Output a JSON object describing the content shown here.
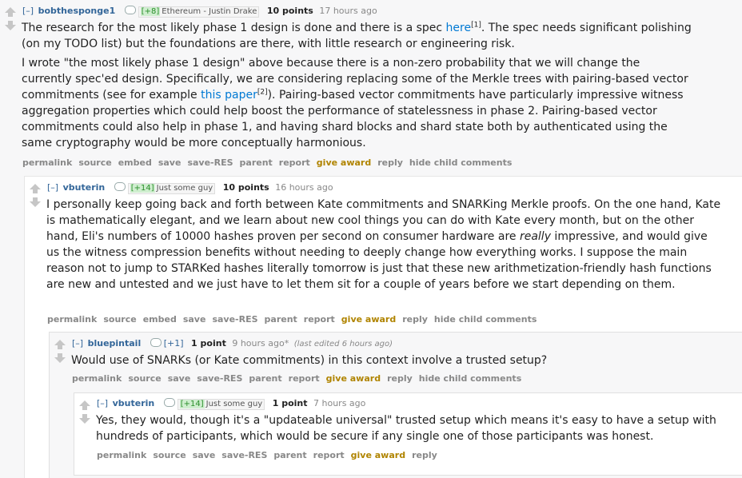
{
  "comments": [
    {
      "expand": "[–]",
      "author": "bobthesponge1",
      "karma": "[+8]",
      "flair": "Ethereum - Justin Drake",
      "score": "10 points",
      "time": "17 hours ago",
      "p1_a": "The research for the most likely phase 1 design is done and there is a spec ",
      "p1_link": "here",
      "p1_sup": "[1]",
      "p1_b": ". The spec needs significant polishing (on my TODO list) but the foundations are there, with little research or engineering risk.",
      "p2_a": "I wrote \"the most likely phase 1 design\" above because there is a non-zero probability that we will change the currently spec'ed design. Specifically, we are considering replacing some of the Merkle trees with pairing-based vector commitments (see for example ",
      "p2_link": "this paper",
      "p2_sup": "[2]",
      "p2_b": "). Pairing-based vector commitments have particularly impressive witness aggregation properties which could help boost the performance of statelessness in phase 2. Pairing-based vector commitments could also help in phase 1, and having shard blocks and shard state both by authenticated using the same cryptography would be more conceptually harmonious.",
      "buttons": [
        "permalink",
        "source",
        "embed",
        "save",
        "save-RES",
        "parent",
        "report",
        "give award",
        "reply",
        "hide child comments"
      ]
    },
    {
      "expand": "[–]",
      "author": "vbuterin",
      "karma": "[+14]",
      "flair": "Just some guy",
      "score": "10 points",
      "time": "16 hours ago",
      "p1_a": "I personally keep going back and forth between Kate commitments and SNARKing Merkle proofs. On the one hand, Kate is mathematically elegant, and we learn about new cool things you can do with Kate every month, but on the other hand, Eli's numbers of 10000 hashes proven per second on consumer hardware are ",
      "p1_em": "really",
      "p1_b": " impressive, and would give us the witness compression benefits without needing to deeply change how everything works. I suppose the main reason not to jump to STARKed hashes literally tomorrow is just that these new arithmetization-friendly hash functions are new and untested and we just have to let them sit for a couple of years before we start depending on them.",
      "buttons": [
        "permalink",
        "source",
        "embed",
        "save",
        "save-RES",
        "parent",
        "report",
        "give award",
        "reply",
        "hide child comments"
      ]
    },
    {
      "expand": "[–]",
      "author": "bluepintail",
      "karma": "[+1]",
      "score": "1 point",
      "time": "9 hours ago*",
      "edited": "(last edited 6 hours ago)",
      "p1": "Would use of SNARKs (or Kate commitments) in this context involve a trusted setup?",
      "buttons": [
        "permalink",
        "source",
        "save",
        "save-RES",
        "parent",
        "report",
        "give award",
        "reply",
        "hide child comments"
      ]
    },
    {
      "expand": "[–]",
      "author": "vbuterin",
      "karma": "[+14]",
      "flair": "Just some guy",
      "score": "1 point",
      "time": "7 hours ago",
      "p1": "Yes, they would, though it's a \"updateable universal\" trusted setup which means it's easy to have a setup with hundreds of participants, which would be secure if any single one of those participants was honest.",
      "buttons": [
        "permalink",
        "source",
        "save",
        "save-RES",
        "parent",
        "report",
        "give award",
        "reply"
      ]
    }
  ],
  "icons": {
    "up": "upvote-arrow-icon",
    "down": "downvote-arrow-icon"
  },
  "colors": {
    "award": "#b08400",
    "link": "#0079d3",
    "author": "#336699",
    "karma": "#2b8f2b"
  }
}
